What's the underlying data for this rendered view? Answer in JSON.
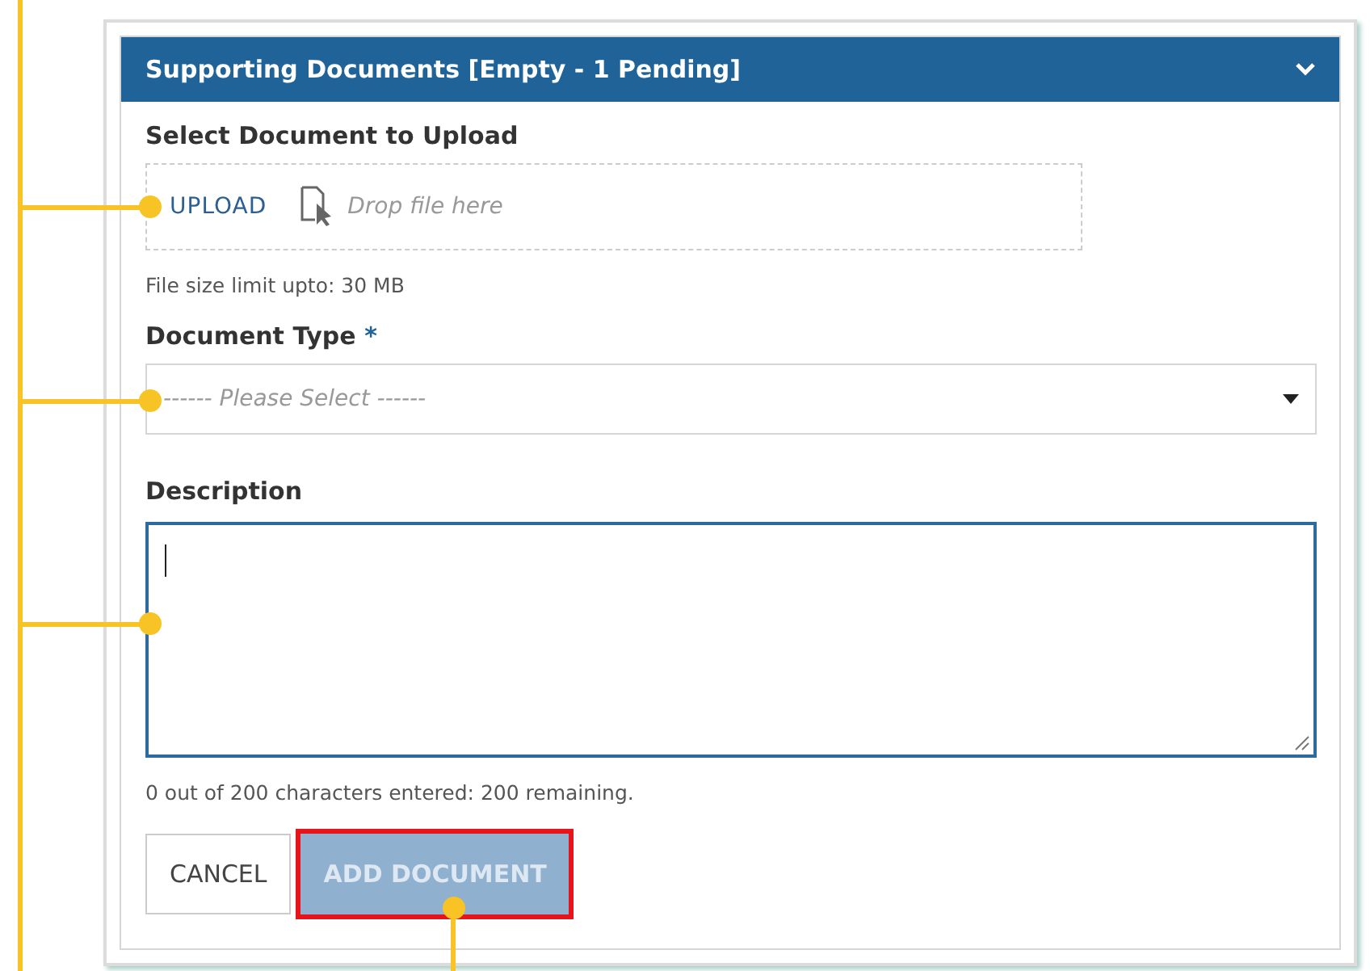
{
  "panel": {
    "title": "Supporting Documents [Empty - 1 Pending]",
    "expanded": true
  },
  "upload": {
    "label": "Select Document to Upload",
    "button": "UPLOAD",
    "drop_hint": "Drop file here",
    "limit_note": "File size limit upto: 30 MB"
  },
  "document_type": {
    "label": "Document Type",
    "required_mark": "*",
    "placeholder": "------ Please Select ------"
  },
  "description": {
    "label": "Description",
    "counter": "0 out of 200 characters entered: 200 remaining."
  },
  "buttons": [
    {
      "label": "CANCEL",
      "kind": "secondary",
      "disabled": false,
      "highlighted": false
    },
    {
      "label": "ADD DOCUMENT",
      "kind": "primary",
      "disabled": true,
      "highlighted": true
    }
  ]
}
